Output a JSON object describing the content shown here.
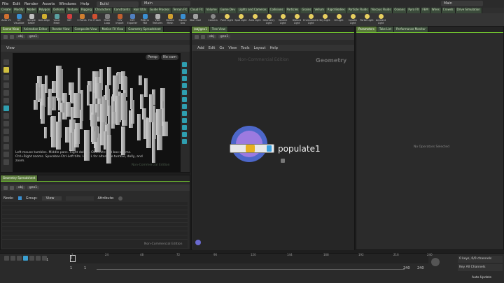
{
  "menubar": {
    "items": [
      "File",
      "Edit",
      "Render",
      "Assets",
      "Windows",
      "Help"
    ],
    "desktop": "Build",
    "workspace_left": "Main",
    "workspace_right": "Main"
  },
  "shelf": {
    "tabs": [
      "Create",
      "Modify",
      "Model",
      "Polygon",
      "Deform",
      "Texture",
      "Rigging",
      "Characters",
      "Constraints",
      "Hair Utils",
      "Guide Process",
      "Terrain FX",
      "Cloud FX",
      "Volume",
      "Game Dev",
      "Lights and Cameras",
      "Collisions",
      "Particles",
      "Grains",
      "Vellum",
      "Rigid Bodies",
      "Particle Fluids",
      "Viscous Fluids",
      "Oceans",
      "Pyro FX",
      "FEM",
      "Wires",
      "Crowds",
      "Drive Simulation"
    ],
    "left_tools": [
      "Auto UV",
      "UV Visualize",
      "Simple Baker",
      "Axis Align",
      "Voxel Mesh",
      "VAT",
      "3 Points",
      "Fire Preset",
      "Make Loop",
      "CSV Import",
      "CSV Exporter",
      "RBD to FBX",
      "VDB Textures",
      "Delete Mesh",
      "Sweep Geo",
      "Start Go2"
    ],
    "right_tools": [
      "Camera",
      "Point Light",
      "Spot Light",
      "Area Light",
      "Geometry Light",
      "Volume Light",
      "Distant Light",
      "Environment Light",
      "Sky Light",
      "GI Light",
      "Caustic Light",
      "Portal Light",
      "Ambient Light"
    ]
  },
  "left_pane": {
    "tabs": [
      "Scene View",
      "Animation Editor",
      "Render View",
      "Composite View",
      "Motion FX View",
      "Geometry Spreadsheet"
    ],
    "path": [
      "obj",
      "geo1"
    ],
    "view_label": "View",
    "persp_label": "Persp",
    "cam_label": "No cam",
    "help_text": "Left mouse tumbles. Middle pans. Right dollies. Ctrl+Alt+Left box-zooms. Ctrl+Right zooms. Spacebar-Ctrl-Left tilts. Hold L for alternate tumble, dolly, and zoom.",
    "watermark": "Non-Commercial Edition"
  },
  "mid_pane": {
    "tabs": [
      "/obj/geo1",
      "Tree View"
    ],
    "path": [
      "obj",
      "geo1"
    ],
    "menu": [
      "Add",
      "Edit",
      "Go",
      "View",
      "Tools",
      "Layout",
      "Help"
    ],
    "watermark": "Non-Commercial Edition",
    "context": "Geometry",
    "node_name": "populate1"
  },
  "right_pane": {
    "tabs": [
      "Parameters",
      "Take List",
      "Performance Monitor"
    ],
    "message": "No Operators Selected"
  },
  "spreadsheet": {
    "tabs": [
      "Geometry Spreadsheet"
    ],
    "path": [
      "obj",
      "geo1"
    ],
    "node_label": "Node:",
    "group_label": "Group:",
    "view_label": "View",
    "attrib_label": "Attribute:",
    "watermark": "Non-Commercial Edition"
  },
  "timeline": {
    "frame": "1",
    "ticks": [
      "1",
      "24",
      "48",
      "72",
      "96",
      "120",
      "144",
      "168",
      "192",
      "216",
      "240"
    ],
    "start": "1",
    "start2": "1",
    "end": "240",
    "end2": "240",
    "keys_label": "0 keys, 0/0 channels",
    "key_all": "Key All Channels",
    "auto_update": "Auto Update"
  }
}
